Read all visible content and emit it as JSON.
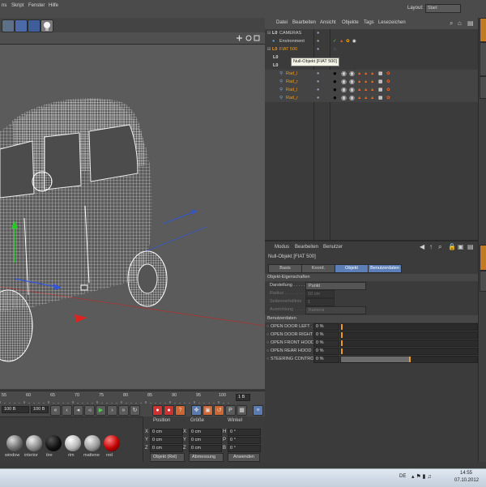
{
  "menu": {
    "items": [
      "ns",
      "Skript",
      "Fenster",
      "Hilfe"
    ]
  },
  "layout": {
    "label": "Layout:",
    "value": "Start"
  },
  "object_manager": {
    "menu": [
      "Datei",
      "Bearbeiten",
      "Ansicht",
      "Objekte",
      "Tags",
      "Lesezeichen"
    ],
    "tooltip": "Null-Objekt [FIAT 500]",
    "rows": [
      {
        "name": "CAMERAS",
        "indent": 0
      },
      {
        "name": "Environment",
        "indent": 0
      },
      {
        "name": "FIAT 500",
        "indent": 0
      },
      {
        "name": "Rad_l",
        "indent": 2
      },
      {
        "name": "Rad_r",
        "indent": 2
      },
      {
        "name": "Rad_l",
        "indent": 2
      },
      {
        "name": "Rad_r",
        "indent": 2
      }
    ]
  },
  "attributes": {
    "menu": [
      "Modus",
      "Bearbeiten",
      "Benutzer"
    ],
    "title": "Null-Objekt [FIAT 500]",
    "tabs": [
      "Basis",
      "Koord.",
      "Objekt",
      "Benutzerdaten"
    ],
    "section_object": "Objekt-Eigenschaften",
    "display_label": "Darstellung . . . . .",
    "display_value": "Punkt",
    "radius_label": "Radius . . . . . . . . .",
    "radius_value": "10 cm",
    "aspect_label": "Seitenverhältnis",
    "aspect_value": "1",
    "orientation_label": "Ausrichtung . . . . .",
    "orientation_value": "Kamera",
    "section_user": "Benutzerdaten",
    "userdata": [
      {
        "label": "OPEN DOOR LEFT . .",
        "value": "0 %",
        "fill": 0
      },
      {
        "label": "OPEN DOOR RIGHT",
        "value": "0 %",
        "fill": 0
      },
      {
        "label": "OPEN FRONT HOOD",
        "value": "0 %",
        "fill": 0
      },
      {
        "label": "OPEN REAR HOOD",
        "value": "0 %",
        "fill": 0
      },
      {
        "label": "STEERING CONTROL",
        "value": "0 %",
        "fill": 0.5
      }
    ]
  },
  "timeline": {
    "ticks": [
      "55",
      "60",
      "65",
      "70",
      "75",
      "80",
      "85",
      "90",
      "95",
      "100"
    ],
    "frame_field": "1 B",
    "start_field": "100 B",
    "end_field": "100 B"
  },
  "materials": {
    "labels": [
      "window",
      "interior",
      "tire",
      "rim",
      "mattene",
      "red"
    ],
    "colors": [
      "#6f6f6f",
      "#8a8a8a",
      "#111111",
      "#b5b5b5",
      "#9a9a9a",
      "#c00000"
    ]
  },
  "coordinates": {
    "headers": [
      "Position",
      "Größe",
      "Winkel"
    ],
    "axes": [
      "X",
      "Y",
      "Z"
    ],
    "size_axes": [
      "X",
      "Y",
      "Z"
    ],
    "rot_axes": [
      "H",
      "P",
      "B"
    ],
    "pos": [
      "0 cm",
      "0 cm",
      "0 cm"
    ],
    "size": [
      "0 cm",
      "0 cm",
      "0 cm"
    ],
    "rot": [
      "0 °",
      "0 °",
      "0 °"
    ],
    "mode_select": "Objekt (Rel)",
    "size_select": "Abmessung",
    "apply": "Anwenden"
  },
  "taskbar": {
    "lang": "DE",
    "time": "14:55",
    "date": "07.10.2012"
  },
  "colors": {
    "accent_orange": "#f29a1f",
    "selected_blue": "#5a7bb0",
    "tab_active": "#5b7fb6"
  }
}
